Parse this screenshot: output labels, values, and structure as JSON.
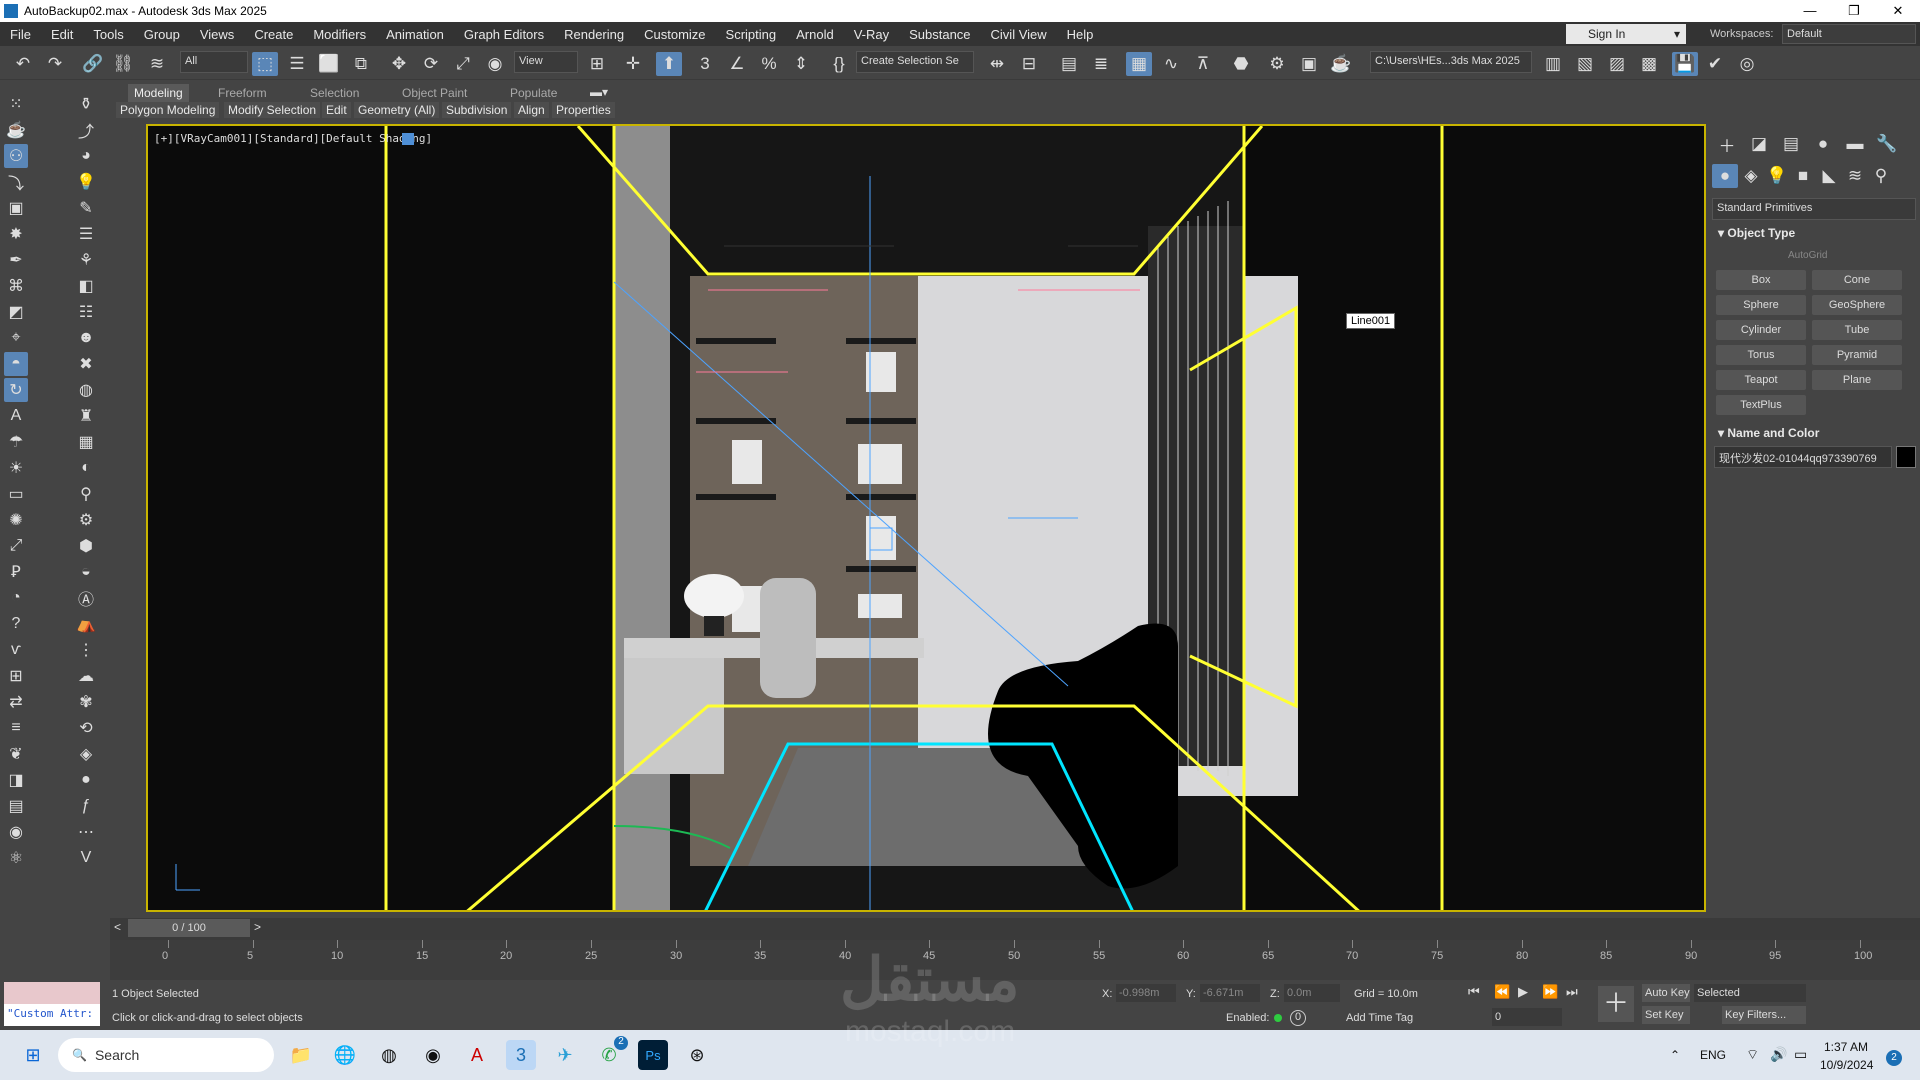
{
  "window": {
    "title": "AutoBackup02.max - Autodesk 3ds Max 2025",
    "minimize": "—",
    "maximize": "❐",
    "close": "✕"
  },
  "menu": [
    "File",
    "Edit",
    "Tools",
    "Group",
    "Views",
    "Create",
    "Modifiers",
    "Animation",
    "Graph Editors",
    "Rendering",
    "Customize",
    "Scripting",
    "Arnold",
    "V-Ray",
    "Substance",
    "Civil View",
    "Help"
  ],
  "signin": "Sign In",
  "workspaces": {
    "label": "Workspaces:",
    "value": "Default"
  },
  "toolbar": {
    "filter": "All",
    "refcoord": "View",
    "selset": "Create Selection Se",
    "project": "C:\\Users\\HEs...3ds Max 2025"
  },
  "ribbon": {
    "tabs": [
      "Modeling",
      "Freeform",
      "Selection",
      "Object Paint",
      "Populate"
    ],
    "sub": [
      "Polygon Modeling",
      "Modify Selection",
      "Edit",
      "Geometry (All)",
      "Subdivision",
      "Align",
      "Properties"
    ]
  },
  "viewport": {
    "label": "[+][VRayCam001][Standard][Default Shading]",
    "tooltip": "Line001"
  },
  "panel": {
    "dropdown": "Standard Primitives",
    "object_type": "Object Type",
    "autogrid": "AutoGrid",
    "buttons": [
      "Box",
      "Cone",
      "Sphere",
      "GeoSphere",
      "Cylinder",
      "Tube",
      "Torus",
      "Pyramid",
      "Teapot",
      "Plane",
      "TextPlus"
    ],
    "name_color": "Name and Color",
    "object_name": "现代沙发02-01044qq973390769",
    "object_color": "#000000"
  },
  "timeslider": {
    "frame": "0 / 100"
  },
  "trackbar": {
    "ticks": [
      "0",
      "5",
      "10",
      "15",
      "20",
      "25",
      "30",
      "35",
      "40",
      "45",
      "50",
      "55",
      "60",
      "65",
      "70",
      "75",
      "80",
      "85",
      "90",
      "95",
      "100"
    ]
  },
  "status": {
    "custom": "\"Custom Attr:",
    "selected": "1 Object Selected",
    "prompt": "Click or click-and-drag to select objects",
    "x_label": "X:",
    "x": "-0.998m",
    "y_label": "Y:",
    "y": "-6.671m",
    "z_label": "Z:",
    "z": "0.0m",
    "grid": "Grid = 10.0m",
    "enabled": "Enabled:",
    "enabled_val": "0",
    "addtime": "Add Time Tag",
    "autokey": "Auto Key",
    "setkey": "Set Key",
    "keymode": "Selected",
    "keyfilters": "Key Filters...",
    "frame_field": "0"
  },
  "taskbar": {
    "search": "Search",
    "lang": "ENG",
    "time": "1:37 AM",
    "date": "10/9/2024",
    "badge": "2",
    "whatsapp_badge": "2"
  },
  "watermark": {
    "arabic": "مستقل",
    "latin": "mostaql.com"
  }
}
